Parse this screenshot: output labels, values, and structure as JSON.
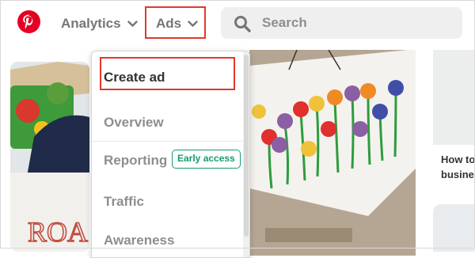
{
  "header": {
    "logo_icon": "pinterest-logo-icon",
    "analytics_label": "Analytics",
    "ads_label": "Ads",
    "search_placeholder": "Search"
  },
  "ads_menu": {
    "items": [
      {
        "label": "Create ad"
      },
      {
        "label": "Overview"
      },
      {
        "label": "Reporting",
        "badge": "Early access"
      },
      {
        "label": "Traffic"
      },
      {
        "label": "Awareness"
      }
    ]
  },
  "feed": {
    "left_pin_text": "ROA",
    "right_pin_caption_line1": "How to",
    "right_pin_caption_line2": "busine"
  },
  "colors": {
    "brand": "#e60023",
    "highlight_box": "#e0392b",
    "badge_green": "#159c6a"
  }
}
